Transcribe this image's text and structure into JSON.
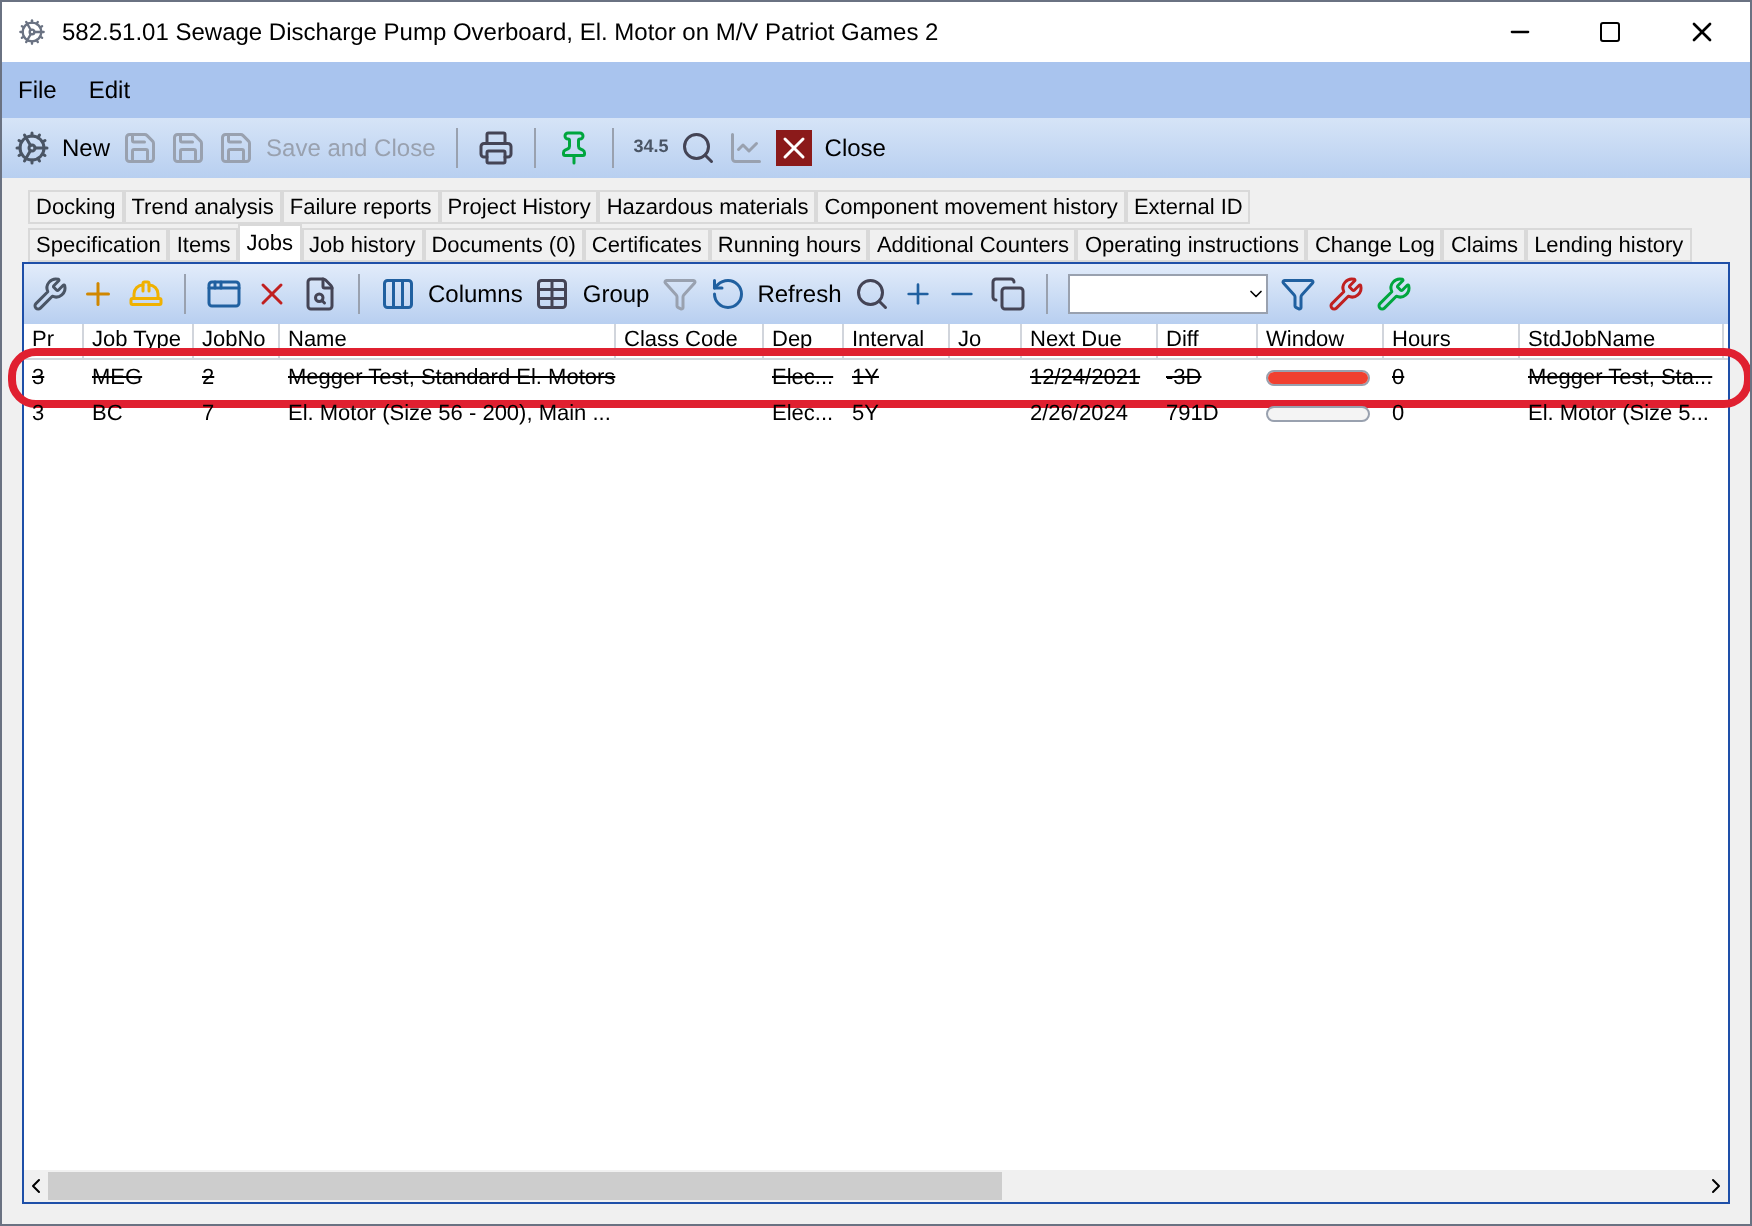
{
  "window": {
    "title": "582.51.01 Sewage Discharge Pump Overboard, El. Motor on M/V Patriot Games 2"
  },
  "menu": [
    "File",
    "Edit"
  ],
  "toolbar": {
    "new": {
      "label": "New"
    },
    "save_close": {
      "label": "Save and Close",
      "disabled": true
    },
    "zoom_value": "34.5",
    "close": {
      "label": "Close"
    }
  },
  "tabs_row_1": [
    {
      "label": "Docking",
      "selected": false
    },
    {
      "label": "Trend analysis",
      "selected": false
    },
    {
      "label": "Failure reports",
      "selected": false
    },
    {
      "label": "Project History",
      "selected": false
    },
    {
      "label": "Hazardous materials",
      "selected": false
    },
    {
      "label": "Component movement history",
      "selected": false
    },
    {
      "label": "External ID",
      "selected": false
    }
  ],
  "tabs_row_2": [
    {
      "label": "Specification",
      "selected": false
    },
    {
      "label": "Items",
      "selected": false
    },
    {
      "label": "Jobs",
      "selected": true
    },
    {
      "label": "Job history",
      "selected": false
    },
    {
      "label": "Documents (0)",
      "selected": false
    },
    {
      "label": "Certificates",
      "selected": false
    },
    {
      "label": "Running hours",
      "selected": false
    },
    {
      "label": "Additional Counters",
      "selected": false
    },
    {
      "label": "Operating instructions",
      "selected": false
    },
    {
      "label": "Change Log",
      "selected": false
    },
    {
      "label": "Claims",
      "selected": false
    },
    {
      "label": "Lending history",
      "selected": false
    }
  ],
  "jobs_toolbar": {
    "columns": "Columns",
    "group": "Group",
    "refresh": "Refresh"
  },
  "table": {
    "columns": [
      "Pr",
      "Job Type",
      "JobNo",
      "Name",
      "Class Code",
      "Dep",
      "Interval",
      "Jo",
      "Next Due",
      "Diff",
      "Window",
      "Hours",
      "StdJobName"
    ],
    "rows": [
      {
        "struck": true,
        "highlighted": true,
        "cells": [
          "3",
          "MEG",
          "2",
          "Megger Test, Standard El. Motors",
          "",
          "Elec...",
          "1Y",
          "",
          "12/24/2021",
          "-3D",
          "",
          "0",
          "Megger Test, Sta..."
        ],
        "window": {
          "level": 1
        }
      },
      {
        "struck": false,
        "highlighted": false,
        "cells": [
          "3",
          "BC",
          "7",
          "El. Motor (Size 56 - 200), Main ...",
          "",
          "Elec...",
          "5Y",
          "",
          "2/26/2024",
          "791D",
          "",
          "0",
          "El. Motor (Size 5..."
        ],
        "window": {
          "level": 0
        }
      }
    ]
  }
}
